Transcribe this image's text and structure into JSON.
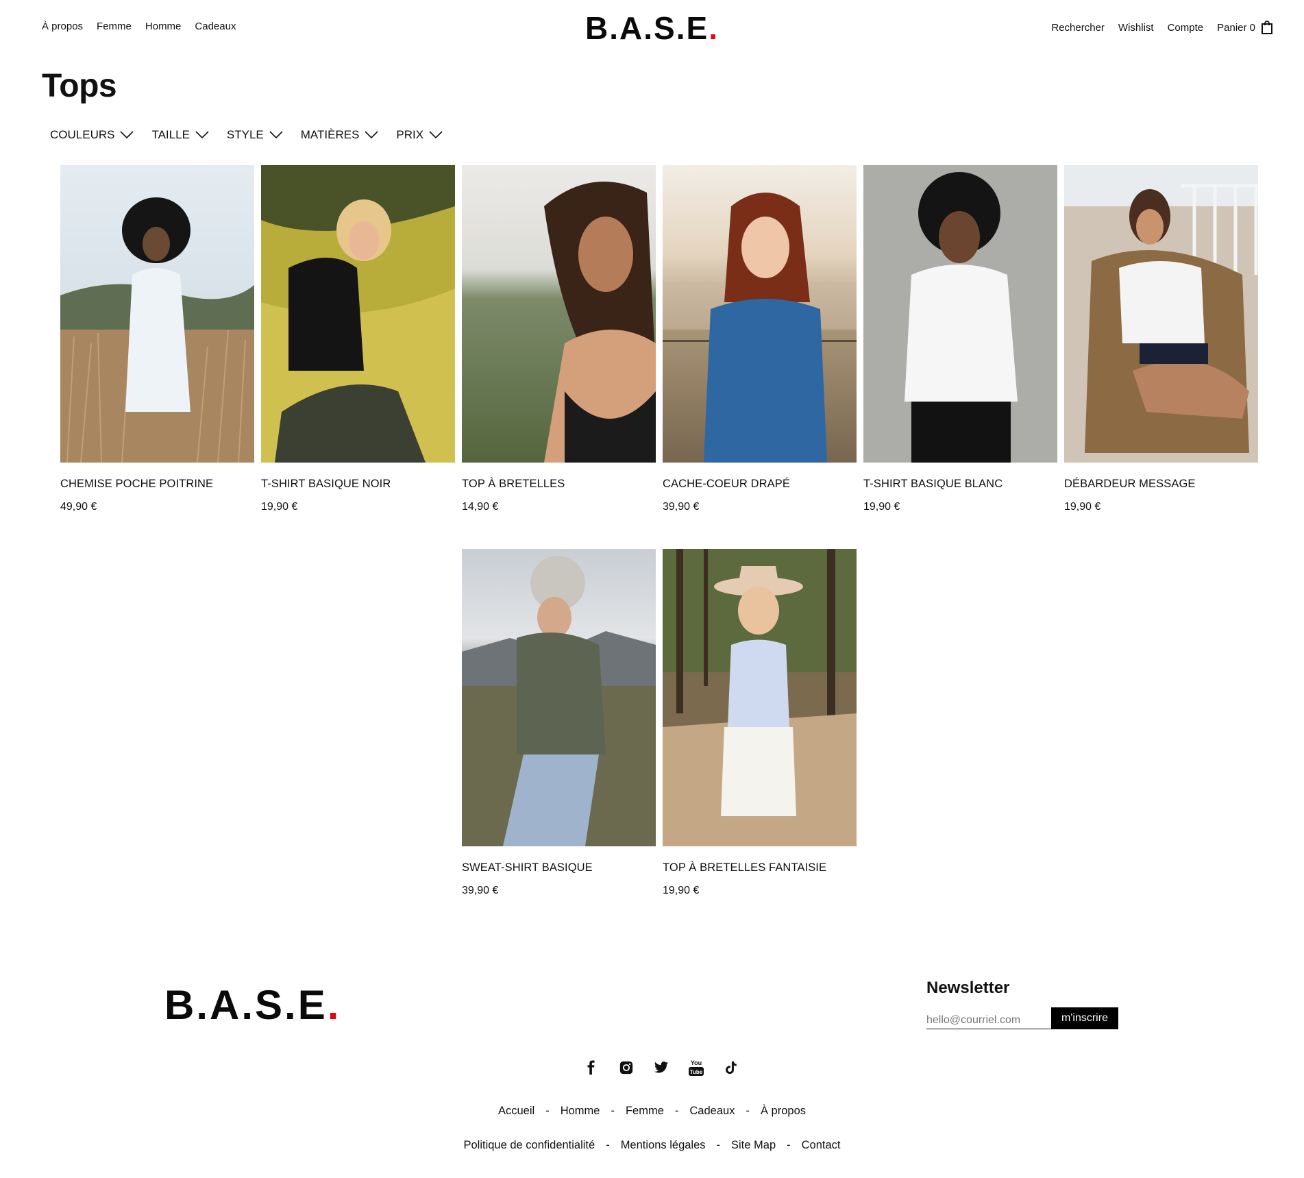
{
  "header": {
    "nav_left": [
      "À propos",
      "Femme",
      "Homme",
      "Cadeaux"
    ],
    "logo_text": "B.A.S.E",
    "logo_dot": ".",
    "nav_right": [
      "Rechercher",
      "Wishlist",
      "Compte",
      "Panier 0"
    ],
    "cart_icon": "shopping-bag-icon"
  },
  "page": {
    "title": "Tops",
    "filters": [
      "COULEURS",
      "TAILLE",
      "STYLE",
      "MATIÈRES",
      "PRIX"
    ]
  },
  "products": [
    {
      "name": "CHEMISE POCHE POITRINE",
      "price": "49,90 €"
    },
    {
      "name": "T-SHIRT BASIQUE NOIR",
      "price": "19,90 €"
    },
    {
      "name": "TOP À BRETELLES",
      "price": "14,90 €"
    },
    {
      "name": "CACHE-COEUR DRAPÉ",
      "price": "39,90 €"
    },
    {
      "name": "T-SHIRT BASIQUE BLANC",
      "price": "19,90 €"
    },
    {
      "name": "DÉBARDEUR MESSAGE",
      "price": "19,90 €"
    },
    {
      "name": "SWEAT-SHIRT BASIQUE",
      "price": "39,90 €"
    },
    {
      "name": "TOP À BRETELLES FANTAISIE",
      "price": "19,90 €"
    }
  ],
  "footer": {
    "logo_text": "B.A.S.E",
    "logo_dot": ".",
    "newsletter": {
      "title": "Newsletter",
      "placeholder": "hello@courriel.com",
      "button": "m'inscrire"
    },
    "socials": [
      "facebook-icon",
      "instagram-icon",
      "twitter-icon",
      "youtube-icon",
      "tiktok-icon"
    ],
    "links_row1": [
      "Accueil",
      "Homme",
      "Femme",
      "Cadeaux",
      "À propos"
    ],
    "links_row2": [
      "Politique de confidentialité",
      "Mentions légales",
      "Site Map",
      "Contact"
    ],
    "separator": "-"
  },
  "colors": {
    "accent_red": "#e30613",
    "text": "#111111",
    "button_bg": "#000000"
  }
}
